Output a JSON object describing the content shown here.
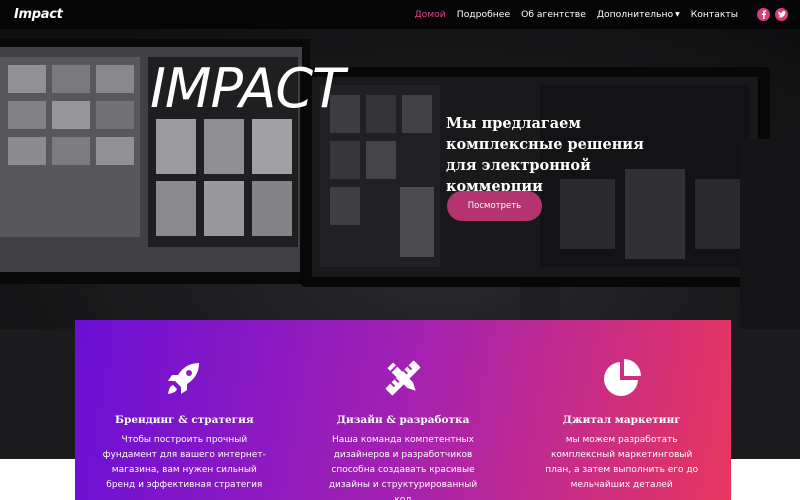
{
  "brand": "Impact",
  "nav": {
    "items": [
      {
        "label": "Домой"
      },
      {
        "label": "Подробнее"
      },
      {
        "label": "Об агентстве"
      },
      {
        "label": "Дополнительно"
      },
      {
        "label": "Контакты"
      }
    ],
    "active_index": 0,
    "active_color": "#e0448f",
    "socials": [
      {
        "icon": "facebook-icon",
        "glyph": "f"
      },
      {
        "icon": "twitter-icon",
        "glyph": "t"
      }
    ],
    "social_color": "#d63b7a"
  },
  "hero": {
    "title": "IMPACT",
    "tagline": "Мы предлагаем комплексные решения для электронной коммерции",
    "button_label": "Посмотреть",
    "button_color": "#b33470"
  },
  "features": [
    {
      "icon": "rocket-icon",
      "title": "Брендинг & стратегия",
      "description": "Чтобы построить прочный фундамент для вашего интернет-магазина, вам нужен сильный бренд и эффективная стратегия"
    },
    {
      "icon": "pencil-ruler-icon",
      "title": "Дизайн & разработка",
      "description": "Наша команда компетентных дизайнеров и разработчиков способна создавать красивые дизайны и структурированный код"
    },
    {
      "icon": "pie-chart-icon",
      "title": "Джитал маркетинг",
      "description": "мы можем разработать комплексный маркетинговый план, а затем выполнить его до мельчайших деталей"
    }
  ],
  "features_gradient": [
    "#6a0fd6",
    "#a321b2",
    "#e8365e"
  ]
}
